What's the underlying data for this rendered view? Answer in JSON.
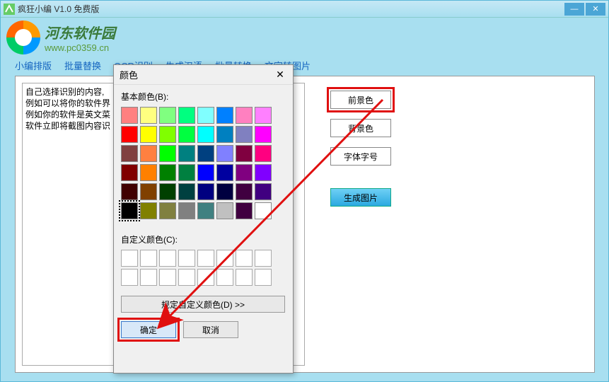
{
  "window": {
    "title": "疯狂小编 V1.0 免费版",
    "minimize": "—",
    "close": "✕"
  },
  "logo": {
    "cn": "河东软件园",
    "url": "www.pc0359.cn"
  },
  "tabs": [
    "小编排版",
    "批量替换",
    "OCR识别",
    "生成汉语",
    "批量转换",
    "文字转图片"
  ],
  "textContent": "自己选择识别的内容,\n例如可以将你的软件界\n例如你的软件是英文菜\n软件立即将截图内容识",
  "buttons": {
    "foreground": "前景色",
    "background": "背景色",
    "fontSize": "字体字号",
    "generate": "生成图片"
  },
  "colorDialog": {
    "title": "颜色",
    "basicLabel": "基本颜色(B):",
    "customLabel": "自定义颜色(C):",
    "defineBtn": "规定自定义颜色(D) >>",
    "ok": "确定",
    "cancel": "取消",
    "basicColors": [
      "#ff8080",
      "#ffff80",
      "#80ff80",
      "#00ff80",
      "#80ffff",
      "#0080ff",
      "#ff80c0",
      "#ff80ff",
      "#ff0000",
      "#ffff00",
      "#80ff00",
      "#00ff40",
      "#00ffff",
      "#0080c0",
      "#8080c0",
      "#ff00ff",
      "#804040",
      "#ff8040",
      "#00ff00",
      "#008080",
      "#004080",
      "#8080ff",
      "#800040",
      "#ff0080",
      "#800000",
      "#ff8000",
      "#008000",
      "#008040",
      "#0000ff",
      "#0000a0",
      "#800080",
      "#8000ff",
      "#400000",
      "#804000",
      "#004000",
      "#004040",
      "#000080",
      "#000040",
      "#400040",
      "#400080",
      "#000000",
      "#808000",
      "#808040",
      "#808080",
      "#408080",
      "#c0c0c0",
      "#400040",
      "#ffffff"
    ],
    "selectedIndex": 40
  }
}
